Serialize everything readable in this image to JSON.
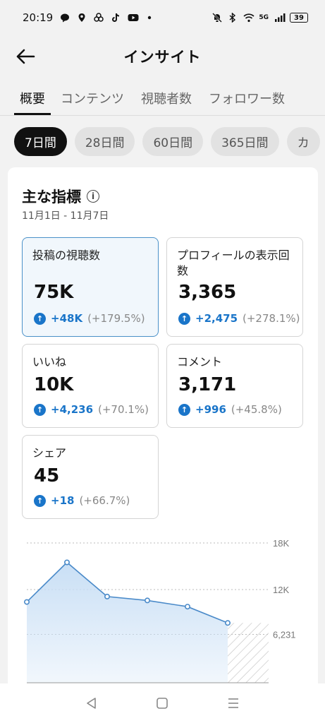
{
  "status_bar": {
    "time": "20:19",
    "battery": "39",
    "network": "5G"
  },
  "header": {
    "title": "インサイト",
    "back_icon": "arrow-left-icon"
  },
  "tabs": [
    {
      "label": "概要",
      "active": true
    },
    {
      "label": "コンテンツ",
      "active": false
    },
    {
      "label": "視聴者数",
      "active": false
    },
    {
      "label": "フォロワー数",
      "active": false
    }
  ],
  "periods": [
    {
      "label": "7日間",
      "active": true
    },
    {
      "label": "28日間",
      "active": false
    },
    {
      "label": "60日間",
      "active": false
    },
    {
      "label": "365日間",
      "active": false
    },
    {
      "label": "カ",
      "active": false
    }
  ],
  "key_metrics": {
    "title": "主な指標",
    "date_range": "11月1日 - 11月7日",
    "metrics": [
      {
        "label": "投稿の視聴数",
        "value": "75K",
        "change": "+48K",
        "pct": "(+179.5%)",
        "selected": true
      },
      {
        "label": "プロフィールの表示回数",
        "value": "3,365",
        "change": "+2,475",
        "pct": "(+278.1%)",
        "selected": false
      },
      {
        "label": "いいね",
        "value": "10K",
        "change": "+4,236",
        "pct": "(+70.1%)",
        "selected": false
      },
      {
        "label": "コメント",
        "value": "3,171",
        "change": "+996",
        "pct": "(+45.8%)",
        "selected": false
      },
      {
        "label": "シェア",
        "value": "45",
        "change": "+18",
        "pct": "(+66.7%)",
        "selected": false
      }
    ]
  },
  "chart_data": {
    "type": "area",
    "x": [
      1,
      2,
      3,
      4,
      5,
      6
    ],
    "values": [
      10400,
      15500,
      11100,
      10600,
      9800,
      7700
    ],
    "yticks": [
      "18K",
      "12K",
      "6,231"
    ],
    "ytick_values": [
      18000,
      12000,
      6231
    ],
    "ylim": [
      0,
      18000
    ],
    "grid": true,
    "colors": {
      "line": "#4a8ac9",
      "fill": "#c9dff5",
      "point_fill": "#ffffff"
    }
  },
  "colors": {
    "accent": "#1a75c9",
    "selected_border": "#4a90c8",
    "selected_bg": "#f1f7fc"
  }
}
